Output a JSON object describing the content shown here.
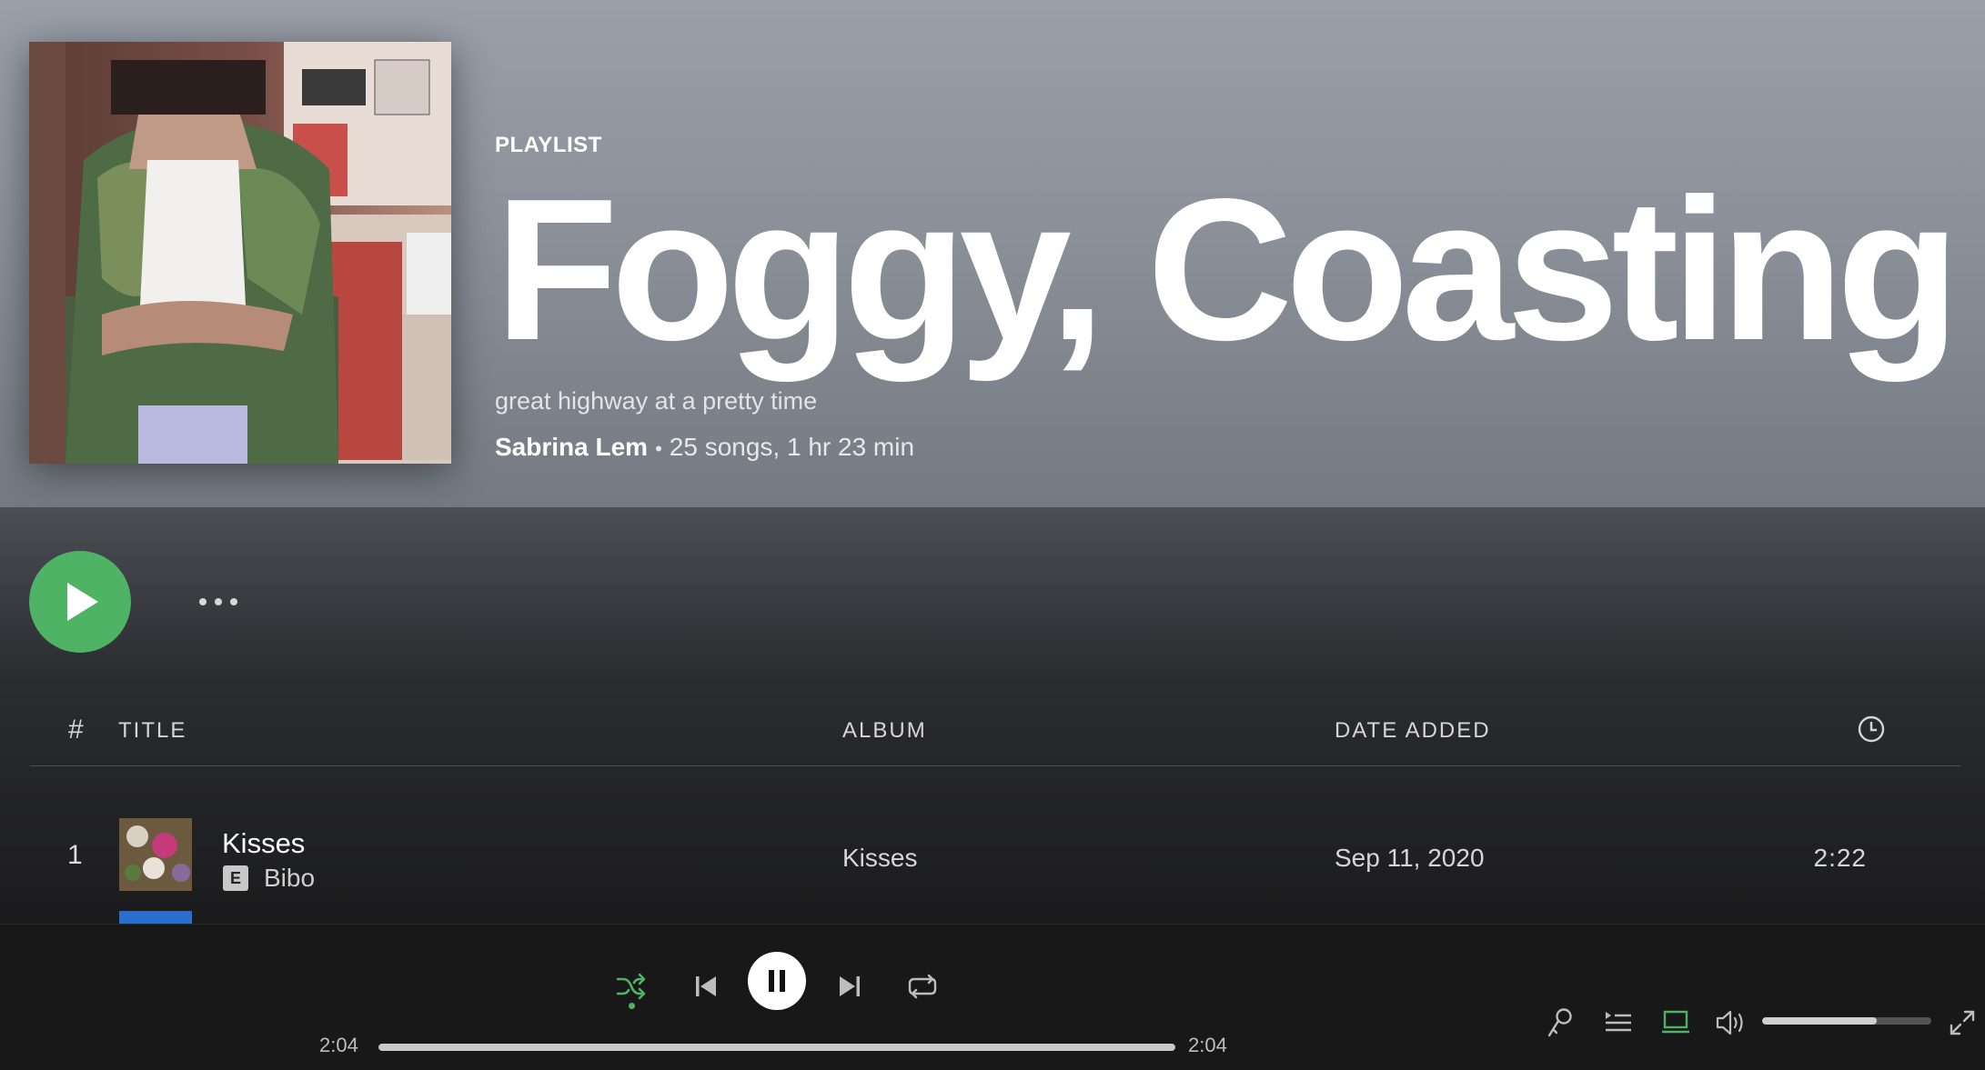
{
  "header": {
    "type_label": "PLAYLIST",
    "title": "Foggy, Coasting",
    "description": "great highway at a pretty time",
    "owner": "Sabrina Lem",
    "stats": "25 songs, 1 hr 23 min"
  },
  "table": {
    "headers": {
      "num": "#",
      "title": "TITLE",
      "album": "ALBUM",
      "date_added": "DATE ADDED"
    },
    "rows": [
      {
        "num": "1",
        "title": "Kisses",
        "explicit": "E",
        "artist": "Bibo",
        "album": "Kisses",
        "date_added": "Sep 11, 2020",
        "duration": "2:22"
      }
    ]
  },
  "player": {
    "current_time": "2:04",
    "total_time": "2:04",
    "progress": 1.0,
    "volume": 0.68,
    "shuffle_active": true,
    "device_active": true
  },
  "icons": {
    "play": "play-icon",
    "more": "more-options-icon",
    "clock": "clock-icon",
    "shuffle": "shuffle-icon",
    "prev": "skip-back-icon",
    "pause": "pause-icon",
    "next": "skip-forward-icon",
    "repeat": "repeat-icon",
    "lyrics": "microphone-icon",
    "queue": "queue-icon",
    "device": "connect-device-icon",
    "volume": "volume-icon",
    "fullscreen": "fullscreen-icon"
  },
  "colors": {
    "accent": "#1db954",
    "play_button": "#4fb366"
  }
}
